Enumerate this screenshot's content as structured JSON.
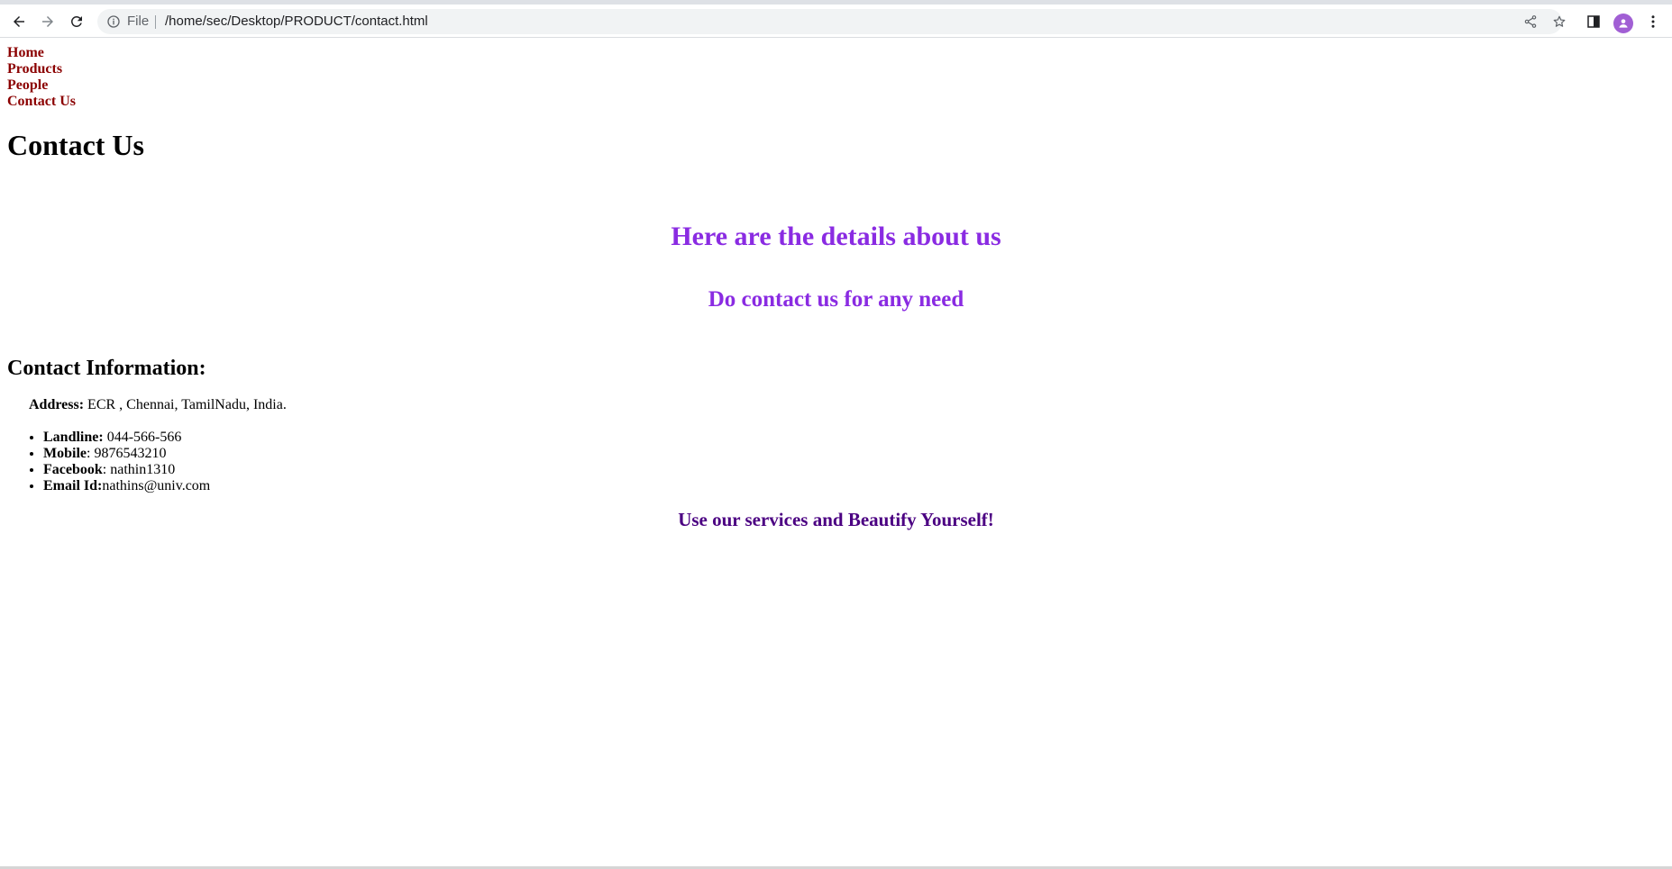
{
  "browser": {
    "site_info_label": "File",
    "url": "/home/sec/Desktop/PRODUCT/contact.html"
  },
  "nav": {
    "items": [
      {
        "label": "Home"
      },
      {
        "label": "Products"
      },
      {
        "label": "People"
      },
      {
        "label": "Contact Us"
      }
    ]
  },
  "page": {
    "title": "Contact Us",
    "details_heading": "Here are the details about us",
    "contact_subheading": "Do contact us for any need",
    "info_heading": "Contact Information:",
    "address": {
      "label": "Address:",
      "value": " ECR , Chennai, TamilNadu, India."
    },
    "contacts": [
      {
        "label": "Landline:",
        "value": " 044-566-566"
      },
      {
        "label": "Mobile",
        "value": ": 9876543210"
      },
      {
        "label": "Facebook",
        "value": ": nathin1310"
      },
      {
        "label": "Email Id:",
        "value": "nathins@univ.com"
      }
    ],
    "services_line": "Use our services and Beautify Yourself!"
  },
  "colors": {
    "nav_link": "#8b0000",
    "heading_purple": "#8a2be2",
    "services_indigo": "#4b0082",
    "avatar": "#a15fd4"
  }
}
